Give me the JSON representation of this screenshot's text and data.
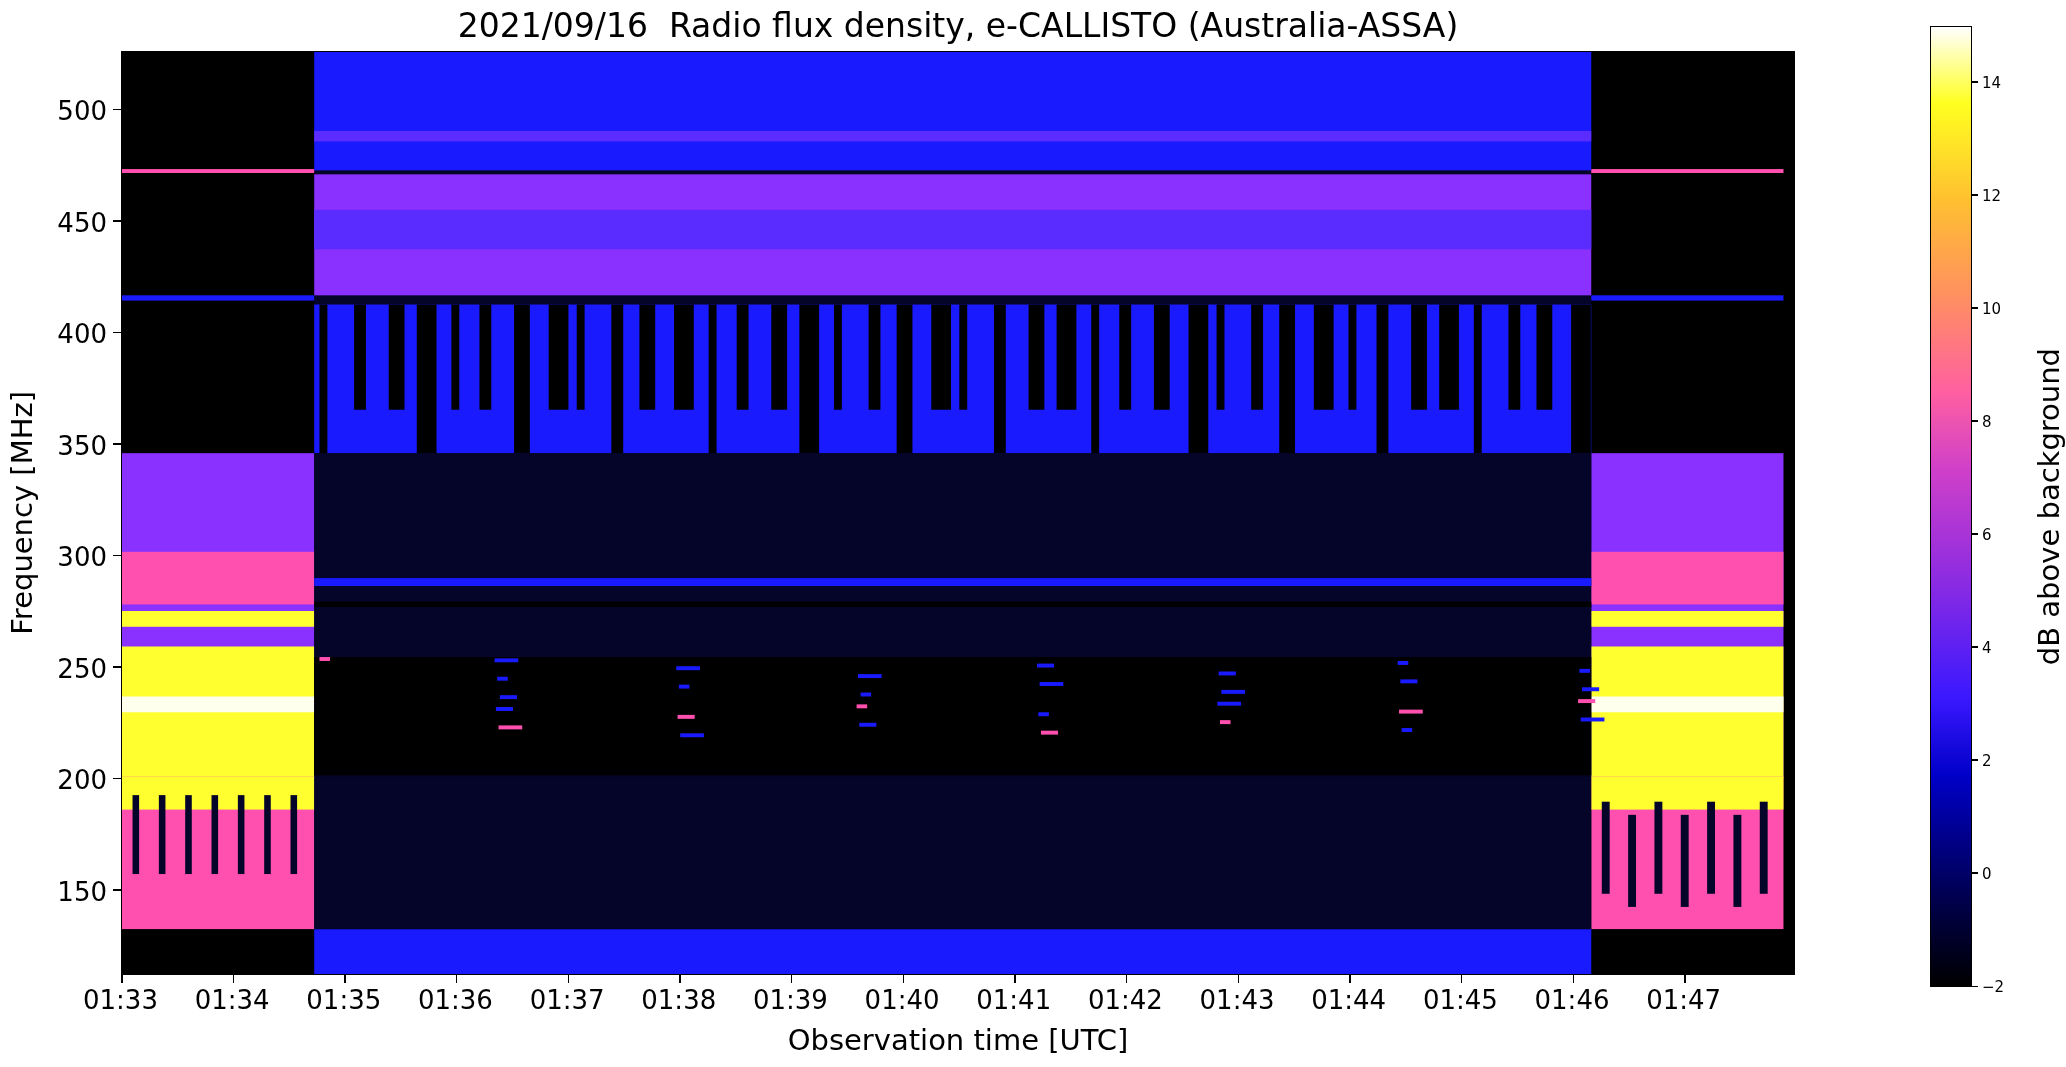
{
  "title": "2021/09/16  Radio flux density, e-CALLISTO (Australia-ASSA)",
  "y_axis": {
    "label": "Frequency [MHz]",
    "ticks": [
      "500",
      "450",
      "400",
      "350",
      "300",
      "250",
      "200",
      "150"
    ]
  },
  "x_axis": {
    "label": "Observation time [UTC]",
    "ticks": [
      "01:33",
      "01:34",
      "01:35",
      "01:36",
      "01:37",
      "01:38",
      "01:39",
      "01:40",
      "01:41",
      "01:42",
      "01:43",
      "01:44",
      "01:45",
      "01:46",
      "01:47"
    ]
  },
  "colorbar": {
    "label": "dB above background",
    "ticks": [
      "14",
      "12",
      "10",
      "8",
      "6",
      "4",
      "2",
      "0",
      "−2"
    ]
  }
}
